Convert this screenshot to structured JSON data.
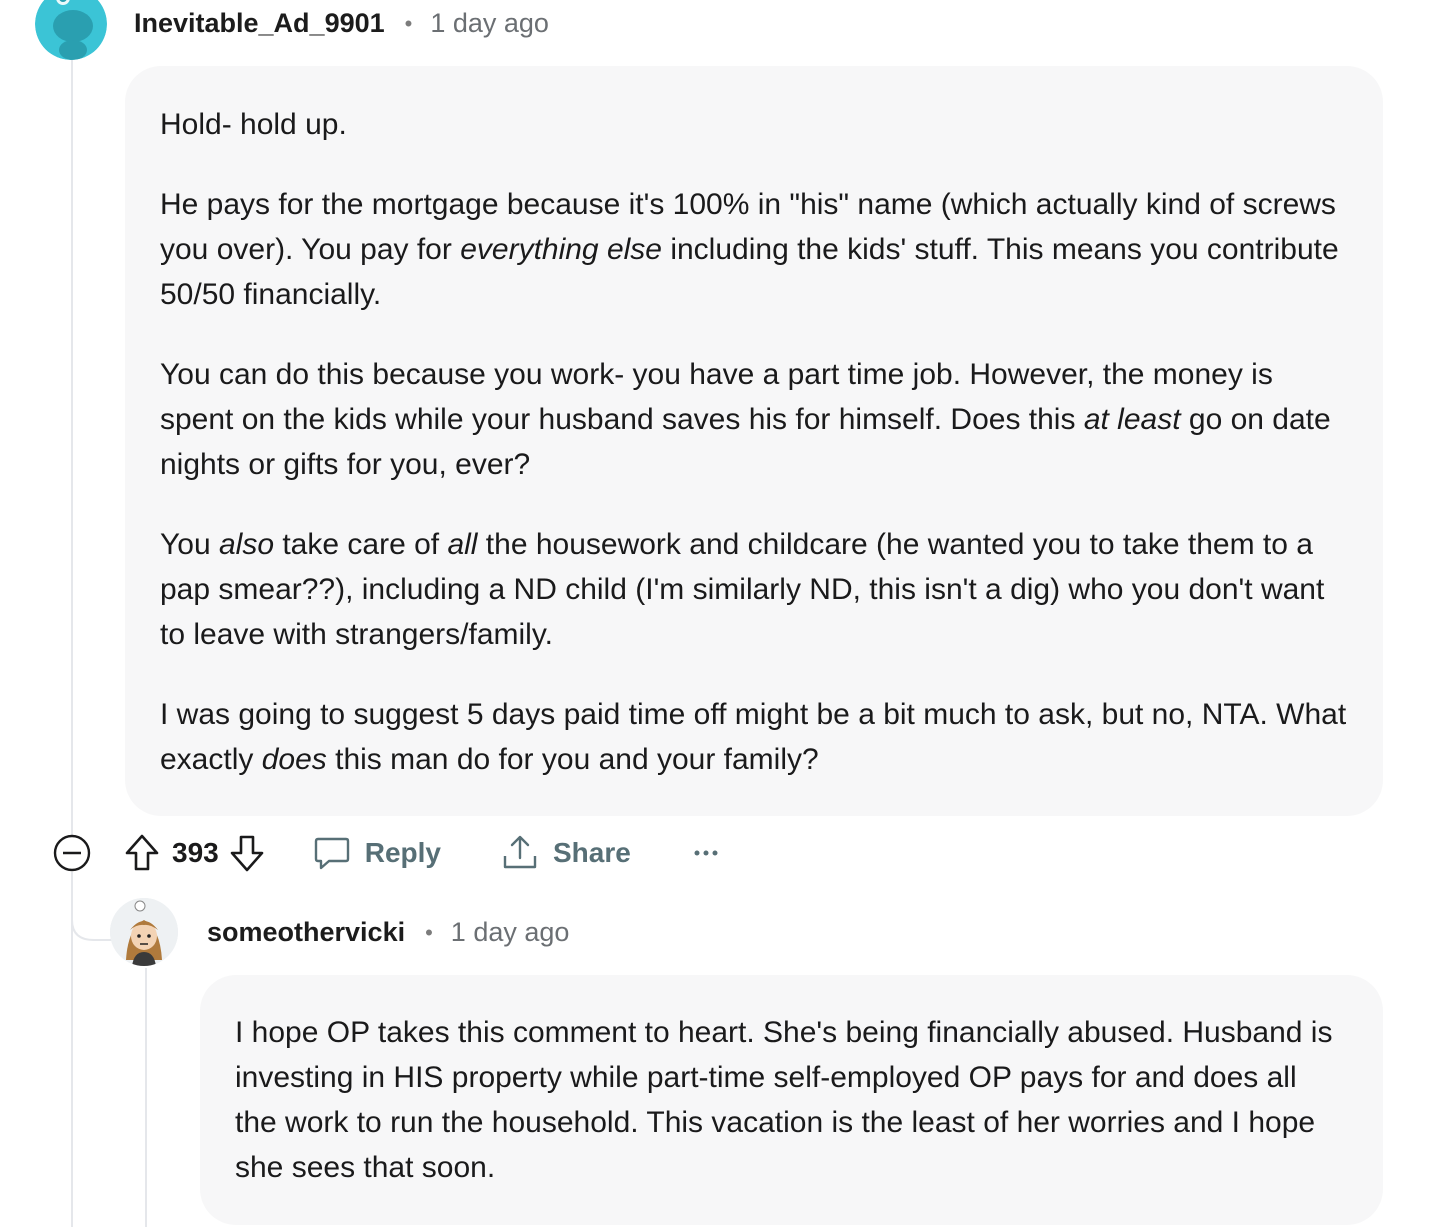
{
  "comments": [
    {
      "username": "Inevitable_Ad_9901",
      "time": "1 day ago",
      "avatar_color": "#3bc4d6",
      "paragraphs": [
        [
          {
            "t": "Hold- hold up."
          }
        ],
        [
          {
            "t": "He pays for the mortgage because it's 100% in \"his\" name (which actually kind of screws you over). You pay for "
          },
          {
            "t": "everything else",
            "i": true
          },
          {
            "t": " including the kids' stuff. This means you contribute 50/50 financially."
          }
        ],
        [
          {
            "t": "You can do this because you work- you have a part time job. However, the money is spent on the kids while your husband saves his for himself. Does this "
          },
          {
            "t": "at least",
            "i": true
          },
          {
            "t": " go on date nights or gifts for you, ever?"
          }
        ],
        [
          {
            "t": "You "
          },
          {
            "t": "also",
            "i": true
          },
          {
            "t": " take care of "
          },
          {
            "t": "all",
            "i": true
          },
          {
            "t": " the housework and childcare (he wanted you to take them to a pap smear??), including a ND child (I'm similarly ND, this isn't a dig) who you don't want to leave with strangers/family."
          }
        ],
        [
          {
            "t": "I was going to suggest 5 days paid time off might be a bit much to ask, but no, NTA. What exactly "
          },
          {
            "t": "does",
            "i": true
          },
          {
            "t": " this man do for you and your family?"
          }
        ]
      ],
      "score": "393",
      "reply_label": "Reply",
      "share_label": "Share",
      "more_label": "···"
    },
    {
      "username": "someothervicki",
      "time": "1 day ago",
      "paragraphs": [
        [
          {
            "t": "I hope OP takes this comment to heart. She's being financially abused. Husband is investing in HIS property while part-time self-employed OP pays for and does all the work to run the household. This vacation is the least of her worries and I hope she sees that soon."
          }
        ]
      ]
    }
  ],
  "icons": [
    "collapse-icon",
    "upvote-icon",
    "downvote-icon",
    "comment-bubble-icon",
    "share-icon",
    "more-icon"
  ]
}
